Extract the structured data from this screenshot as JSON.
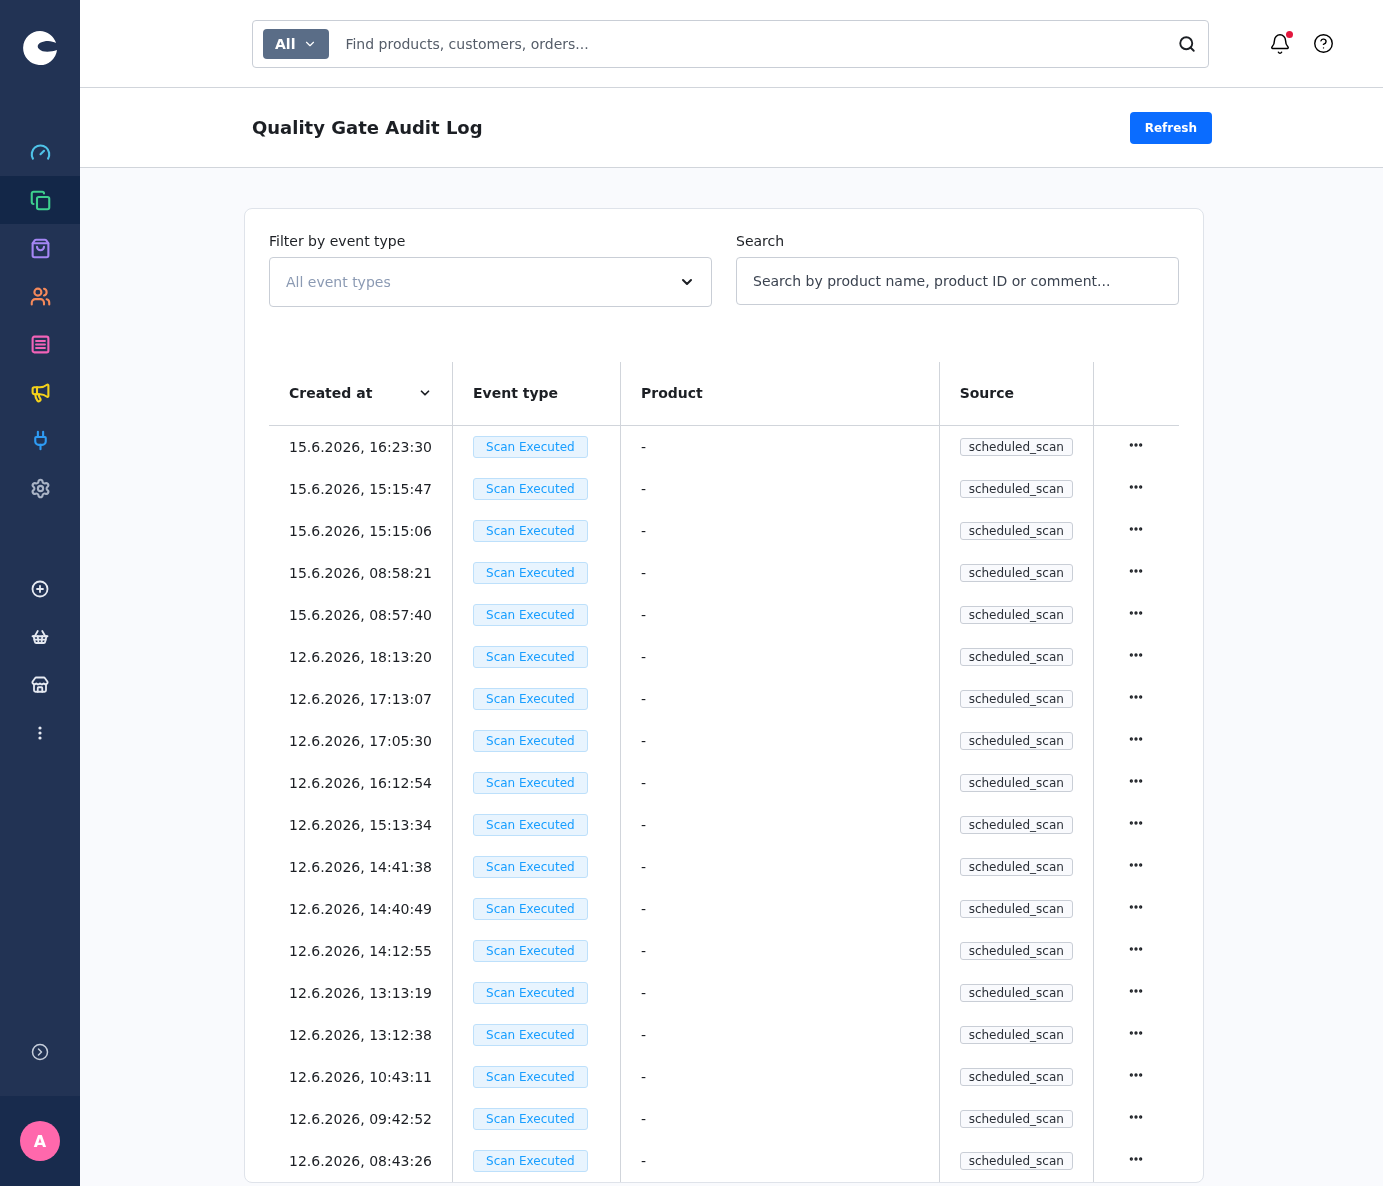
{
  "sidebar": {
    "items": [
      {
        "selected": false,
        "color": "#4fc3e8"
      },
      {
        "selected": true,
        "color": "#3ecf8e"
      },
      {
        "selected": false,
        "color": "#a586f5"
      },
      {
        "selected": false,
        "color": "#f5895a"
      },
      {
        "selected": false,
        "color": "#f263b8"
      },
      {
        "selected": false,
        "color": "#f5d21a"
      },
      {
        "selected": false,
        "color": "#2e9cf5"
      },
      {
        "selected": false,
        "color": "#aab4c6"
      },
      {
        "selected": false,
        "color": "#e6eaf2"
      },
      {
        "selected": false,
        "color": "#e6eaf2"
      },
      {
        "selected": false,
        "color": "#e6eaf2"
      },
      {
        "selected": false,
        "color": "#e6eaf2"
      }
    ],
    "avatar": "A"
  },
  "search": {
    "scope": "All",
    "placeholder": "Find products, customers, orders..."
  },
  "notifications": {
    "unread": true
  },
  "page": {
    "title": "Quality Gate Audit Log",
    "refresh_button": "Refresh"
  },
  "filters": {
    "event_type_label": "Filter by event type",
    "event_type_placeholder": "All event types",
    "search_label": "Search",
    "search_placeholder": "Search by product name, product ID or comment..."
  },
  "table": {
    "columns": [
      "Created at",
      "Event type",
      "Product",
      "Source"
    ],
    "rows": [
      {
        "created_at": "15.6.2026, 16:23:30",
        "event_type": "Scan Executed",
        "product": "-",
        "source": "scheduled_scan"
      },
      {
        "created_at": "15.6.2026, 15:15:47",
        "event_type": "Scan Executed",
        "product": "-",
        "source": "scheduled_scan"
      },
      {
        "created_at": "15.6.2026, 15:15:06",
        "event_type": "Scan Executed",
        "product": "-",
        "source": "scheduled_scan"
      },
      {
        "created_at": "15.6.2026, 08:58:21",
        "event_type": "Scan Executed",
        "product": "-",
        "source": "scheduled_scan"
      },
      {
        "created_at": "15.6.2026, 08:57:40",
        "event_type": "Scan Executed",
        "product": "-",
        "source": "scheduled_scan"
      },
      {
        "created_at": "12.6.2026, 18:13:20",
        "event_type": "Scan Executed",
        "product": "-",
        "source": "scheduled_scan"
      },
      {
        "created_at": "12.6.2026, 17:13:07",
        "event_type": "Scan Executed",
        "product": "-",
        "source": "scheduled_scan"
      },
      {
        "created_at": "12.6.2026, 17:05:30",
        "event_type": "Scan Executed",
        "product": "-",
        "source": "scheduled_scan"
      },
      {
        "created_at": "12.6.2026, 16:12:54",
        "event_type": "Scan Executed",
        "product": "-",
        "source": "scheduled_scan"
      },
      {
        "created_at": "12.6.2026, 15:13:34",
        "event_type": "Scan Executed",
        "product": "-",
        "source": "scheduled_scan"
      },
      {
        "created_at": "12.6.2026, 14:41:38",
        "event_type": "Scan Executed",
        "product": "-",
        "source": "scheduled_scan"
      },
      {
        "created_at": "12.6.2026, 14:40:49",
        "event_type": "Scan Executed",
        "product": "-",
        "source": "scheduled_scan"
      },
      {
        "created_at": "12.6.2026, 14:12:55",
        "event_type": "Scan Executed",
        "product": "-",
        "source": "scheduled_scan"
      },
      {
        "created_at": "12.6.2026, 13:13:19",
        "event_type": "Scan Executed",
        "product": "-",
        "source": "scheduled_scan"
      },
      {
        "created_at": "12.6.2026, 13:12:38",
        "event_type": "Scan Executed",
        "product": "-",
        "source": "scheduled_scan"
      },
      {
        "created_at": "12.6.2026, 10:43:11",
        "event_type": "Scan Executed",
        "product": "-",
        "source": "scheduled_scan"
      },
      {
        "created_at": "12.6.2026, 09:42:52",
        "event_type": "Scan Executed",
        "product": "-",
        "source": "scheduled_scan"
      },
      {
        "created_at": "12.6.2026, 08:43:26",
        "event_type": "Scan Executed",
        "product": "-",
        "source": "scheduled_scan"
      }
    ]
  }
}
